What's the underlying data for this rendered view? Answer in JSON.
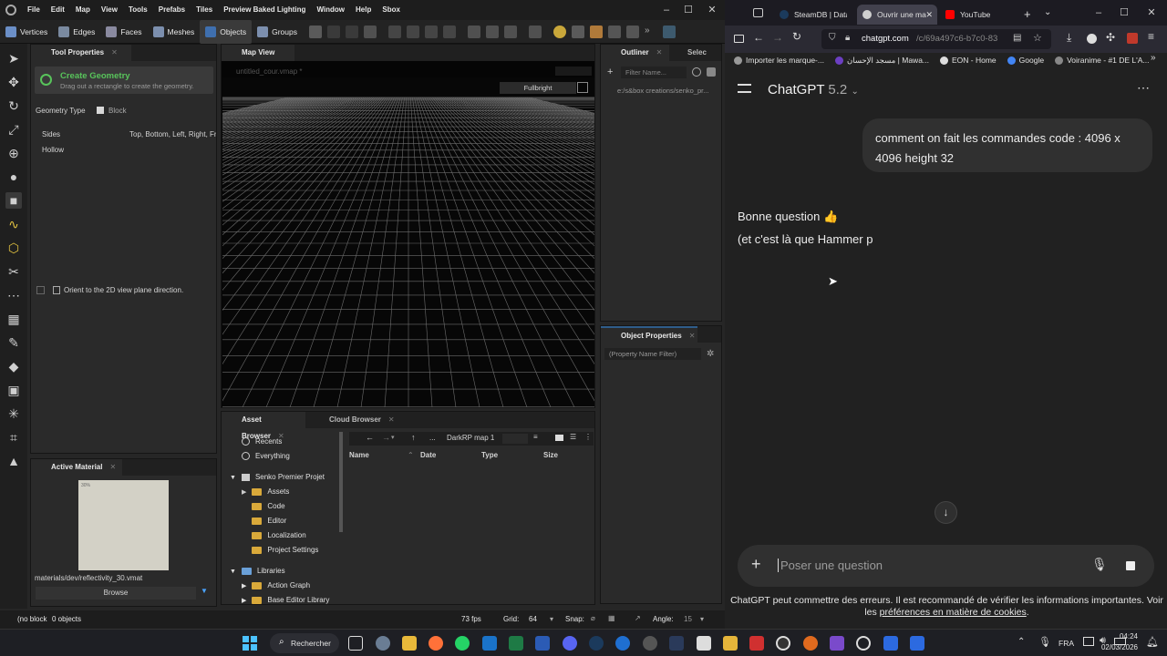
{
  "editor": {
    "menu": [
      "File",
      "Edit",
      "Map",
      "View",
      "Tools",
      "Prefabs",
      "Tiles",
      "Preview Baked Lighting",
      "Window",
      "Help",
      "Sbox"
    ],
    "modes": [
      "Vertices",
      "Edges",
      "Faces",
      "Meshes",
      "Objects",
      "Groups"
    ],
    "tool_properties": {
      "tab": "Tool Properties",
      "title": "Create Geometry",
      "subtitle": "Drag out a rectangle to create the geometry.",
      "geometry_type_label": "Geometry Type",
      "geometry_type_value": "Block",
      "sides_label": "Sides",
      "sides_value": "Top, Bottom, Left, Right, Fr",
      "hollow_label": "Hollow",
      "orient_label": "Orient to the 2D view plane direction."
    },
    "active_material": {
      "tab": "Active Material",
      "path": "materials/dev/reflectivity_30.vmat",
      "browse": "Browse",
      "thumb_label": "30%"
    },
    "map_view": {
      "tab": "Map View",
      "file": "untitled_cour.vmap *",
      "mode": "Fullbright"
    },
    "outliner": {
      "tab": "Outliner",
      "tab2": "Selec",
      "filter_placeholder": "Filter Name...",
      "path": "e:/s&box creations/senko_pr..."
    },
    "object_properties": {
      "tab": "Object Properties",
      "filter_placeholder": "(Property Name Filter)"
    },
    "asset_browser": {
      "tab": "Asset Browser",
      "tab2": "Cloud Browser",
      "location": "DarkRP map 1",
      "dots": "...",
      "columns": [
        "Name",
        "Date",
        "Type",
        "Size"
      ],
      "quick": [
        {
          "label": "Recents"
        },
        {
          "label": "Everything"
        }
      ],
      "project": "Senko Premier Projet",
      "folders": [
        "Assets",
        "Code",
        "Editor",
        "Localization",
        "Project Settings"
      ],
      "libraries": "Libraries",
      "libs": [
        "Action Graph",
        "Base Editor Library"
      ]
    },
    "status": {
      "selection": "(no block",
      "objects": "0 objects",
      "fps": "73 fps",
      "grid_label": "Grid:",
      "grid_value": "64",
      "snap_label": "Snap:",
      "angle_label": "Angle:",
      "angle_value": "15"
    }
  },
  "browser": {
    "tabs": [
      {
        "label": "SteamDB | Datab"
      },
      {
        "label": "Ouvrir une ma"
      },
      {
        "label": "YouTube"
      }
    ],
    "url_host": "chatgpt.com",
    "url_path": "/c/69a497c6-b7c0-83",
    "bookmarks": [
      "Importer les marque-...",
      "مسجد الإحسان | Mawa...",
      "EON - Home",
      "Google",
      "Voiranime - #1 DE L'A..."
    ],
    "chat": {
      "title": "ChatGPT",
      "version": "5.2",
      "user_message": "comment on fait les commandes code : 4096 x 4096 height 32",
      "assistant_line1": "Bonne question 👍",
      "assistant_line2": "(et c'est là que Hammer p",
      "input_placeholder": "Poser une question",
      "disclaimer": "ChatGPT peut commettre des erreurs. Il est recommandé de vérifier les informations importantes. Voir les",
      "disclaimer_link": "préférences en matière de cookies",
      "disclaimer_end": "."
    }
  },
  "taskbar": {
    "search": "Rechercher",
    "lang": "FRA",
    "time": "04:24",
    "date": "02/03/2026"
  },
  "colors": {
    "accent_blue": "#4aa3ff",
    "editor_green": "#58c45b",
    "selection_tab": "#2f5d8a"
  }
}
